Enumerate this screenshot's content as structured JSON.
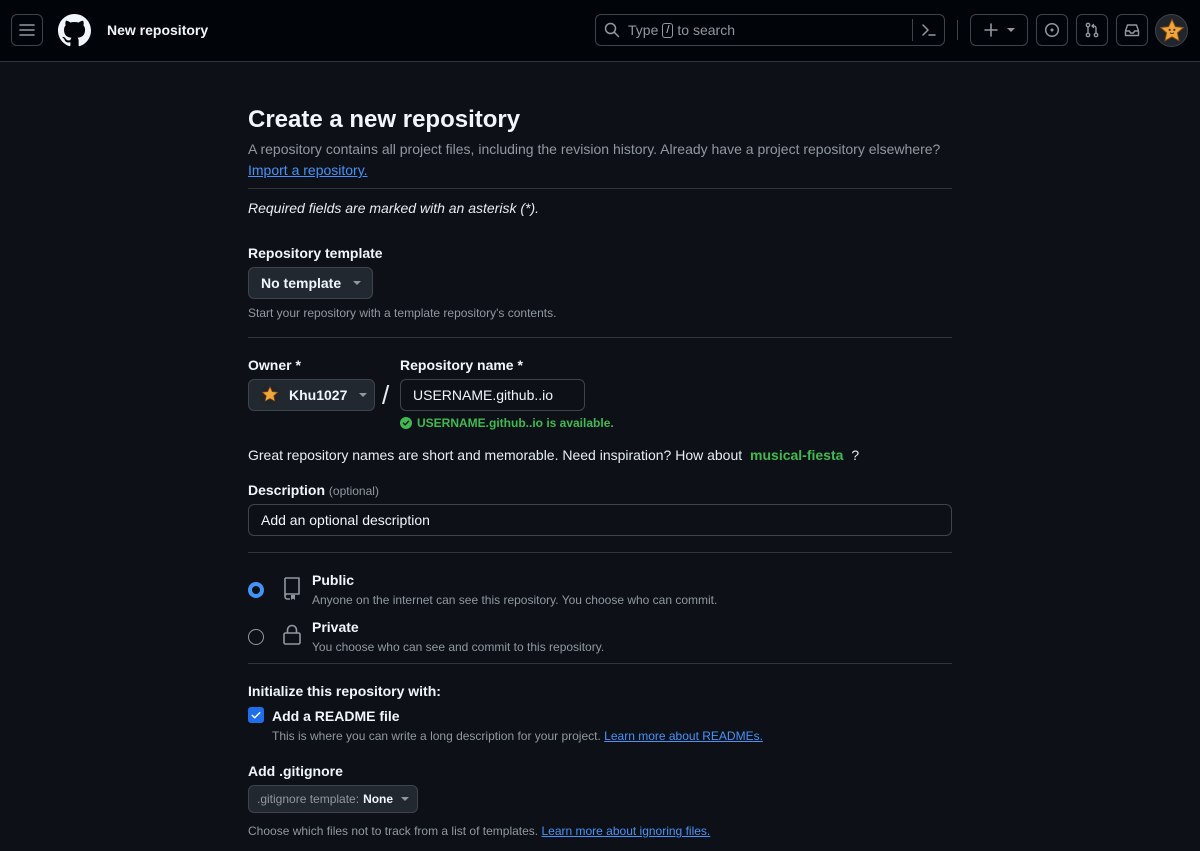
{
  "header": {
    "context_title": "New repository",
    "search": {
      "prefix": "Type",
      "key": "/",
      "suffix": "to search"
    }
  },
  "main": {
    "title": "Create a new repository",
    "subtitle": "A repository contains all project files, including the revision history. Already have a project repository elsewhere?",
    "import_link": "Import a repository.",
    "required_note": "Required fields are marked with an asterisk (*).",
    "template": {
      "label": "Repository template",
      "value": "No template",
      "note": "Start your repository with a template repository's contents."
    },
    "owner": {
      "label": "Owner *",
      "value": "Khu1027"
    },
    "slash": "/",
    "repo_name": {
      "label": "Repository name *",
      "value": "USERNAME.github..io",
      "available": "USERNAME.github..io is available."
    },
    "inspiration": {
      "before": "Great repository names are short and memorable. Need inspiration? How about",
      "suggestion": "musical-fiesta",
      "after": "?"
    },
    "description": {
      "label": "Description",
      "optional": "(optional)",
      "placeholder": "Add an optional description"
    },
    "visibility": {
      "public": {
        "title": "Public",
        "desc": "Anyone on the internet can see this repository. You choose who can commit."
      },
      "private": {
        "title": "Private",
        "desc": "You choose who can see and commit to this repository."
      }
    },
    "init": {
      "label": "Initialize this repository with:",
      "readme": {
        "title": "Add a README file",
        "desc": "This is where you can write a long description for your project.",
        "link": "Learn more about READMEs."
      }
    },
    "gitignore": {
      "label": "Add .gitignore",
      "prefix": ".gitignore template:",
      "value": "None",
      "note": "Choose which files not to track from a list of templates.",
      "link": "Learn more about ignoring files."
    }
  }
}
